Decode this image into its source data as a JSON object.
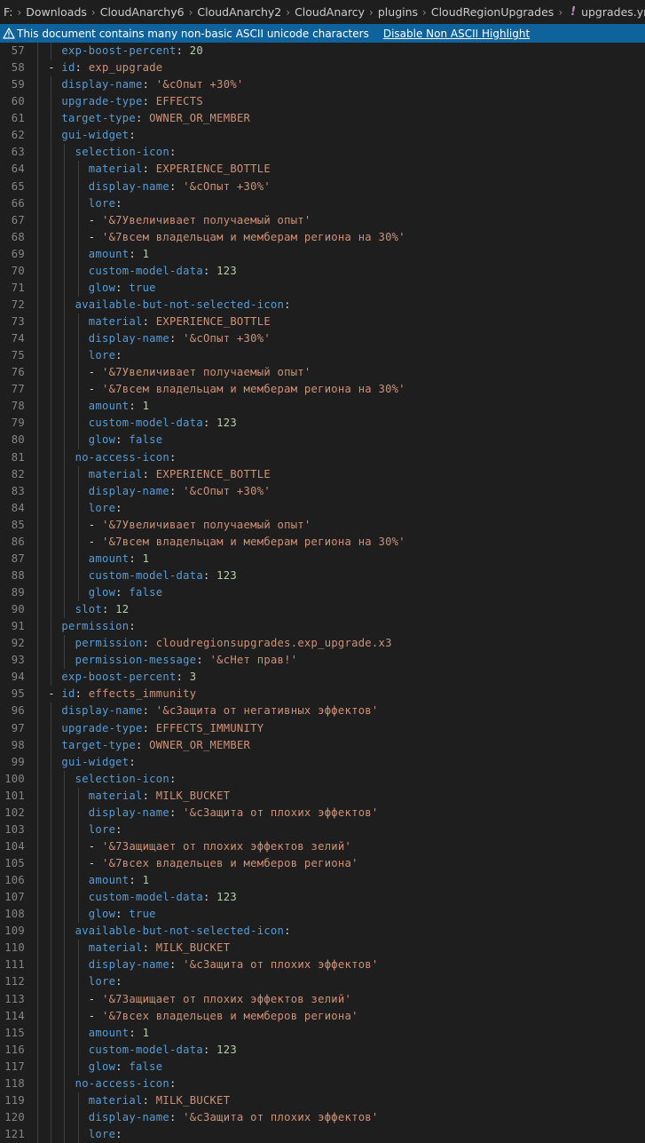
{
  "breadcrumb": {
    "items": [
      "F:",
      "Downloads",
      "CloudAnarchy6",
      "CloudAnarchy2",
      "CloudAnarcy",
      "plugins",
      "CloudRegionUpgrades"
    ],
    "file_name": "upgrades.yml",
    "file_icon": "!"
  },
  "banner": {
    "message": "This document contains many non-basic ASCII unicode characters",
    "action_label": "Disable Non ASCII Highlight"
  },
  "colors": {
    "key": "#569cd6",
    "string": "#ce9178",
    "number": "#b5cea8",
    "punctuation": "#d4d4d4",
    "line_number": "#858585",
    "banner_bg": "#0e639c",
    "editor_bg": "#1e1e1e"
  },
  "editor": {
    "lines": [
      {
        "n": "57",
        "text": "    exp-boost-percent: 20"
      },
      {
        "n": "58",
        "text": "  - id: exp_upgrade"
      },
      {
        "n": "59",
        "text": "    display-name: '&cОпыт +30%'"
      },
      {
        "n": "60",
        "text": "    upgrade-type: EFFECTS"
      },
      {
        "n": "61",
        "text": "    target-type: OWNER_OR_MEMBER"
      },
      {
        "n": "62",
        "text": "    gui-widget:"
      },
      {
        "n": "63",
        "text": "      selection-icon:"
      },
      {
        "n": "64",
        "text": "        material: EXPERIENCE_BOTTLE"
      },
      {
        "n": "65",
        "text": "        display-name: '&cОпыт +30%'"
      },
      {
        "n": "66",
        "text": "        lore:"
      },
      {
        "n": "67",
        "text": "        - '&7Увеличивает получаемый опыт'"
      },
      {
        "n": "68",
        "text": "        - '&7всем владельцам и мемберам региона на 30%'"
      },
      {
        "n": "69",
        "text": "        amount: 1"
      },
      {
        "n": "70",
        "text": "        custom-model-data: 123"
      },
      {
        "n": "71",
        "text": "        glow: true"
      },
      {
        "n": "72",
        "text": "      available-but-not-selected-icon:"
      },
      {
        "n": "73",
        "text": "        material: EXPERIENCE_BOTTLE"
      },
      {
        "n": "74",
        "text": "        display-name: '&cОпыт +30%'"
      },
      {
        "n": "75",
        "text": "        lore:"
      },
      {
        "n": "76",
        "text": "        - '&7Увеличивает получаемый опыт'"
      },
      {
        "n": "77",
        "text": "        - '&7всем владельцам и мемберам региона на 30%'"
      },
      {
        "n": "78",
        "text": "        amount: 1"
      },
      {
        "n": "79",
        "text": "        custom-model-data: 123"
      },
      {
        "n": "80",
        "text": "        glow: false"
      },
      {
        "n": "81",
        "text": "      no-access-icon:"
      },
      {
        "n": "82",
        "text": "        material: EXPERIENCE_BOTTLE"
      },
      {
        "n": "83",
        "text": "        display-name: '&cОпыт +30%'"
      },
      {
        "n": "84",
        "text": "        lore:"
      },
      {
        "n": "85",
        "text": "        - '&7Увеличивает получаемый опыт'"
      },
      {
        "n": "86",
        "text": "        - '&7всем владельцам и мемберам региона на 30%'"
      },
      {
        "n": "87",
        "text": "        amount: 1"
      },
      {
        "n": "88",
        "text": "        custom-model-data: 123"
      },
      {
        "n": "89",
        "text": "        glow: false"
      },
      {
        "n": "90",
        "text": "      slot: 12"
      },
      {
        "n": "91",
        "text": "    permission:"
      },
      {
        "n": "92",
        "text": "      permission: cloudregionsupgrades.exp_upgrade.x3"
      },
      {
        "n": "93",
        "text": "      permission-message: '&cНет прав!'"
      },
      {
        "n": "94",
        "text": "    exp-boost-percent: 3"
      },
      {
        "n": "95",
        "text": "  - id: effects_immunity"
      },
      {
        "n": "96",
        "text": "    display-name: '&cЗащита от негативных эффектов'"
      },
      {
        "n": "97",
        "text": "    upgrade-type: EFFECTS_IMMUNITY"
      },
      {
        "n": "98",
        "text": "    target-type: OWNER_OR_MEMBER"
      },
      {
        "n": "99",
        "text": "    gui-widget:"
      },
      {
        "n": "100",
        "text": "      selection-icon:"
      },
      {
        "n": "101",
        "text": "        material: MILK_BUCKET"
      },
      {
        "n": "102",
        "text": "        display-name: '&cЗащита от плохих эффектов'"
      },
      {
        "n": "103",
        "text": "        lore:"
      },
      {
        "n": "104",
        "text": "        - '&7Защищает от плохих эффектов зелий'"
      },
      {
        "n": "105",
        "text": "        - '&7всех владельцев и мемберов региона'"
      },
      {
        "n": "106",
        "text": "        amount: 1"
      },
      {
        "n": "107",
        "text": "        custom-model-data: 123"
      },
      {
        "n": "108",
        "text": "        glow: true"
      },
      {
        "n": "109",
        "text": "      available-but-not-selected-icon:"
      },
      {
        "n": "110",
        "text": "        material: MILK_BUCKET"
      },
      {
        "n": "111",
        "text": "        display-name: '&cЗащита от плохих эффектов'"
      },
      {
        "n": "112",
        "text": "        lore:"
      },
      {
        "n": "113",
        "text": "        - '&7Защищает от плохих эффектов зелий'"
      },
      {
        "n": "114",
        "text": "        - '&7всех владельцев и мемберов региона'"
      },
      {
        "n": "115",
        "text": "        amount: 1"
      },
      {
        "n": "116",
        "text": "        custom-model-data: 123"
      },
      {
        "n": "117",
        "text": "        glow: false"
      },
      {
        "n": "118",
        "text": "      no-access-icon:"
      },
      {
        "n": "119",
        "text": "        material: MILK_BUCKET"
      },
      {
        "n": "120",
        "text": "        display-name: '&cЗащита от плохих эффектов'"
      },
      {
        "n": "121",
        "text": "        lore:"
      }
    ]
  }
}
